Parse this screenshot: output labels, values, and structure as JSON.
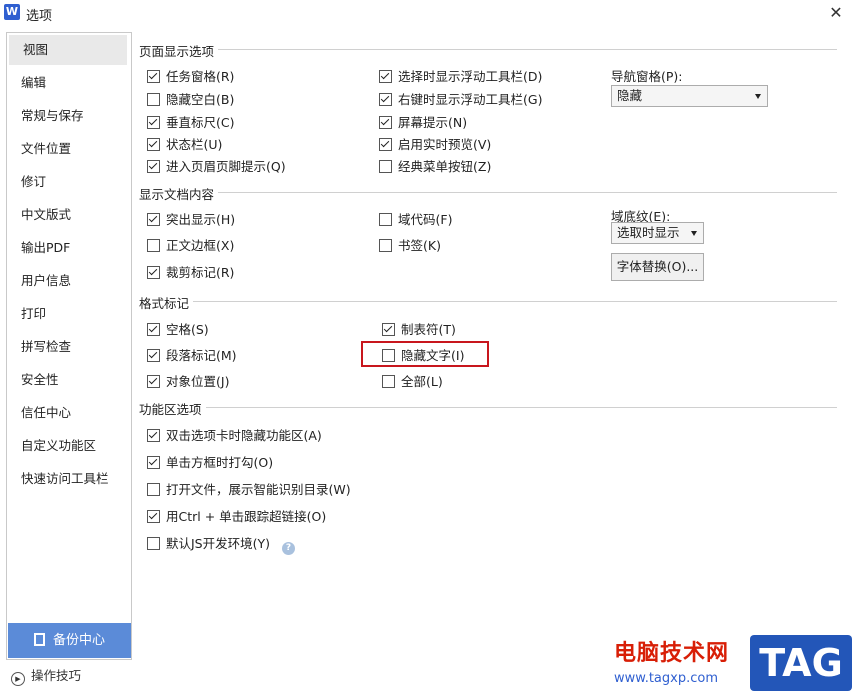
{
  "window": {
    "app_icon_letter": "W",
    "title": "选项",
    "close_glyph": "✕"
  },
  "sidebar": {
    "items": [
      {
        "label": "视图"
      },
      {
        "label": "编辑"
      },
      {
        "label": "常规与保存"
      },
      {
        "label": "文件位置"
      },
      {
        "label": "修订"
      },
      {
        "label": "中文版式"
      },
      {
        "label": "输出PDF"
      },
      {
        "label": "用户信息"
      },
      {
        "label": "打印"
      },
      {
        "label": "拼写检查"
      },
      {
        "label": "安全性"
      },
      {
        "label": "信任中心"
      },
      {
        "label": "自定义功能区"
      },
      {
        "label": "快速访问工具栏"
      }
    ],
    "active_index": 0,
    "backup_label": "备份中心",
    "tips_label": "操作技巧"
  },
  "page_display": {
    "title": "页面显示选项",
    "col1": [
      {
        "label": "任务窗格(R)",
        "checked": true
      },
      {
        "label": "隐藏空白(B)",
        "checked": false
      },
      {
        "label": "垂直标尺(C)",
        "checked": true
      },
      {
        "label": "状态栏(U)",
        "checked": true
      },
      {
        "label": "进入页眉页脚提示(Q)",
        "checked": true
      }
    ],
    "col2": [
      {
        "label": "选择时显示浮动工具栏(D)",
        "checked": true
      },
      {
        "label": "右键时显示浮动工具栏(G)",
        "checked": true
      },
      {
        "label": "屏幕提示(N)",
        "checked": true
      },
      {
        "label": "启用实时预览(V)",
        "checked": true
      },
      {
        "label": "经典菜单按钮(Z)",
        "checked": false
      }
    ],
    "nav_pane_label": "导航窗格(P):",
    "nav_pane_value": "隐藏"
  },
  "doc_content": {
    "title": "显示文档内容",
    "col1": [
      {
        "label": "突出显示(H)",
        "checked": true
      },
      {
        "label": "正文边框(X)",
        "checked": false
      },
      {
        "label": "裁剪标记(R)",
        "checked": true
      }
    ],
    "col2": [
      {
        "label": "域代码(F)",
        "checked": false
      },
      {
        "label": "书签(K)",
        "checked": false
      }
    ],
    "field_shading_label": "域底纹(E):",
    "field_shading_value": "选取时显示",
    "font_sub_button": "字体替换(O)..."
  },
  "format_marks": {
    "title": "格式标记",
    "col1": [
      {
        "label": "空格(S)",
        "checked": true
      },
      {
        "label": "段落标记(M)",
        "checked": true
      },
      {
        "label": "对象位置(J)",
        "checked": true
      }
    ],
    "col2": [
      {
        "label": "制表符(T)",
        "checked": true
      },
      {
        "label": "隐藏文字(I)",
        "checked": false
      },
      {
        "label": "全部(L)",
        "checked": false
      }
    ]
  },
  "ribbon_options": {
    "title": "功能区选项",
    "items": [
      {
        "label": "双击选项卡时隐藏功能区(A)",
        "checked": true
      },
      {
        "label": "单击方框时打勾(O)",
        "checked": true
      },
      {
        "label": "打开文件，展示智能识别目录(W)",
        "checked": false
      },
      {
        "label": "用Ctrl + 单击跟踪超链接(O)",
        "checked": true
      },
      {
        "label": "默认JS开发环境(Y)",
        "checked": false
      }
    ],
    "help_glyph": "?"
  },
  "watermark": {
    "text": "电脑技术网",
    "url": "www.tagxp.com",
    "tag": "TAG"
  },
  "colors": {
    "accent": "#5b8bd8",
    "highlight_border": "#c8161d"
  }
}
